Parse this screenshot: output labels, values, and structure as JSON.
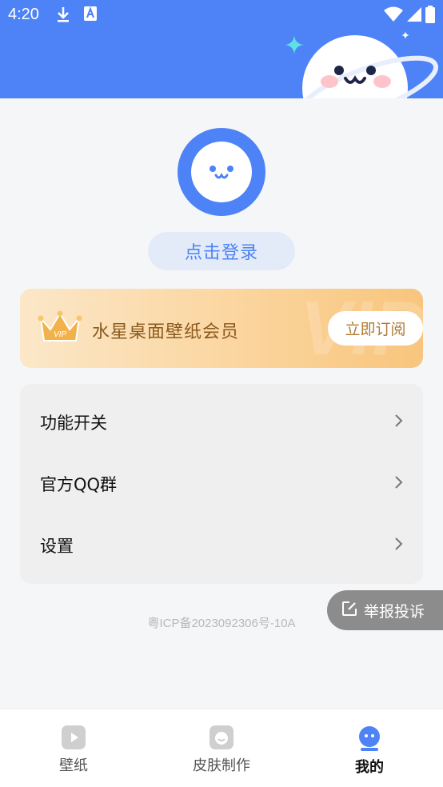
{
  "status_bar": {
    "time": "4:20",
    "left_icons": [
      "download-icon",
      "a-notification-icon"
    ],
    "right_icons": [
      "wifi-icon",
      "signal-icon",
      "battery-icon"
    ]
  },
  "profile": {
    "login_label": "点击登录"
  },
  "vip_card": {
    "title": "水星桌面壁纸会员",
    "subscribe_label": "立即订阅",
    "watermark": "VIP",
    "badge": "VIP"
  },
  "menu": {
    "items": [
      {
        "label": "功能开关"
      },
      {
        "label": "官方QQ群"
      },
      {
        "label": "设置"
      }
    ]
  },
  "footer": {
    "icp": "粤ICP备2023092306号-10A"
  },
  "report": {
    "label": "举报投诉"
  },
  "tabbar": {
    "tabs": [
      {
        "label": "壁纸",
        "icon": "play-icon",
        "active": false
      },
      {
        "label": "皮肤制作",
        "icon": "skin-icon",
        "active": false
      },
      {
        "label": "我的",
        "icon": "face-icon",
        "active": true
      }
    ]
  },
  "colors": {
    "primary": "#4d83f6",
    "vip_text": "#8a5a1f",
    "report_bg": "#8c8c8c"
  }
}
